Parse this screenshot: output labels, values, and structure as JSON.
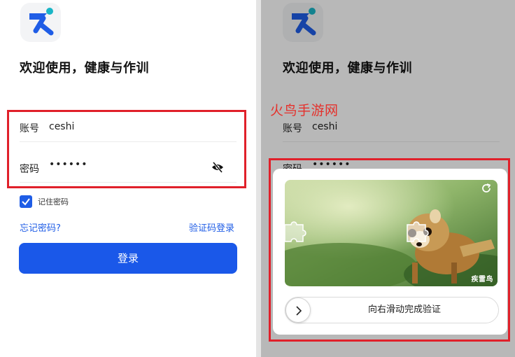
{
  "login": {
    "welcome": "欢迎使用，健康与作训",
    "account_label": "账号",
    "account_value": "ceshi",
    "password_label": "密码",
    "password_mask": "••••••",
    "remember_label": "记住密码",
    "remember_checked": true,
    "forgot_label": "忘记密码?",
    "code_login_label": "验证码登录",
    "login_button": "登录"
  },
  "watermark": "火鸟手游网",
  "captcha": {
    "slider_text": "向右滑动完成验证",
    "brand_text": "疾雷鸟"
  },
  "colors": {
    "primary": "#1a58e9",
    "highlight": "#e0202a",
    "watermark": "#e5302b"
  },
  "icons": [
    "app-logo-icon",
    "eye-off-icon",
    "check-icon",
    "refresh-icon",
    "chevron-right-icon"
  ]
}
